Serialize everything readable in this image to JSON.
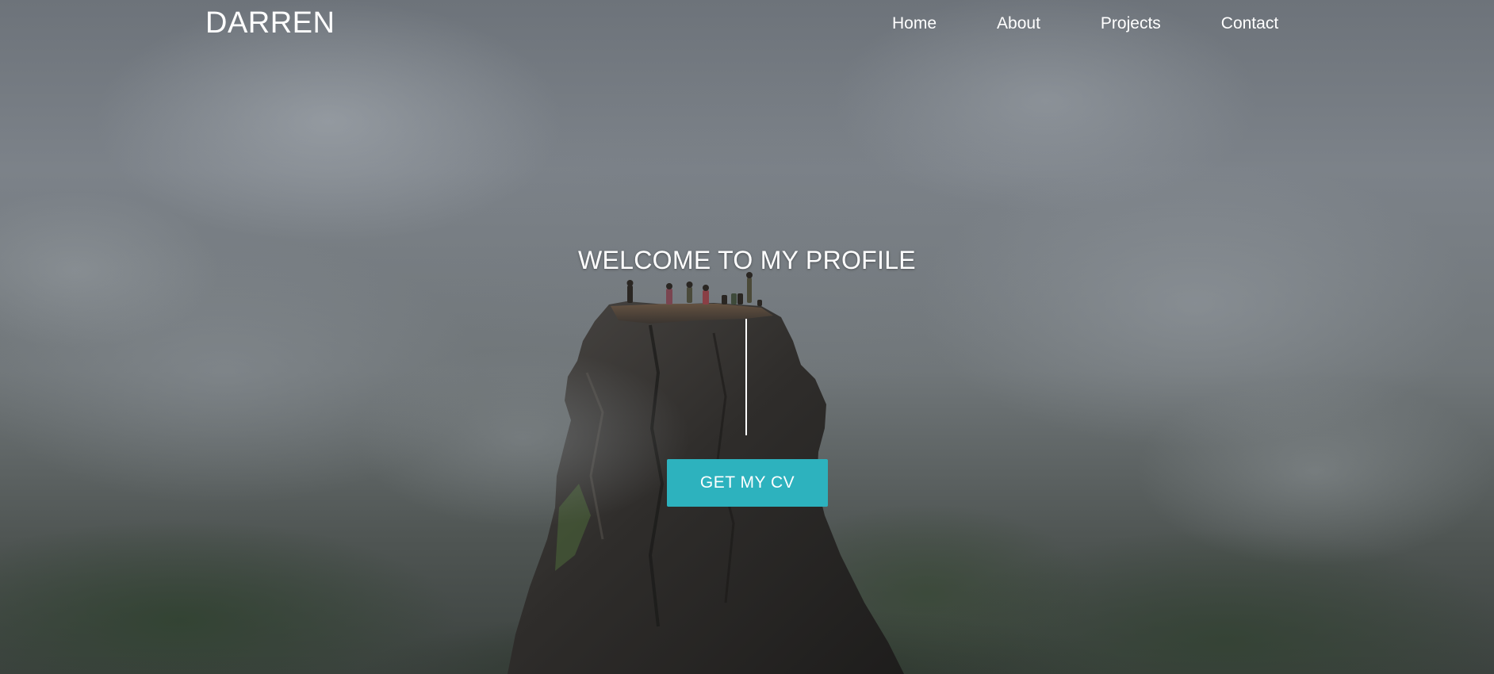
{
  "brand": {
    "name": "DARREN"
  },
  "nav": {
    "items": [
      {
        "label": "Home"
      },
      {
        "label": "About"
      },
      {
        "label": "Projects"
      },
      {
        "label": "Contact"
      }
    ]
  },
  "hero": {
    "heading": "WELCOME TO MY PROFILE",
    "cta_label": "GET MY CV",
    "background": "misty-mountain-peak-photo"
  },
  "colors": {
    "accent": "#2db2be",
    "text": "#ffffff"
  }
}
